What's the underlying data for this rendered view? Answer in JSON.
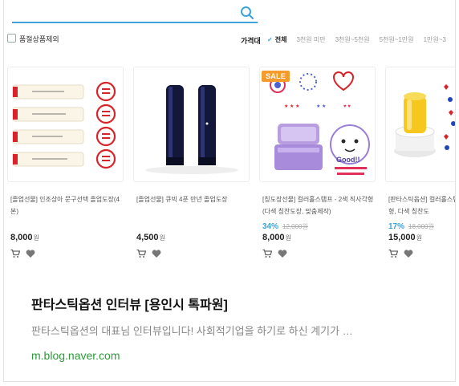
{
  "exclude_label": "품절상품제외",
  "price_filter": {
    "label": "가격대",
    "options": [
      "전체",
      "3천원 미만",
      "3천원~5천원",
      "5천원~1만원",
      "1만원~3"
    ]
  },
  "products": [
    {
      "name": "[졸업선물] 인조상아 문구선택 졸업도장(4본)",
      "discount": "",
      "original_price": "",
      "price": "8,000",
      "currency": "원",
      "sale": ""
    },
    {
      "name": "[졸업선물] 큐빅 4푼 만년 졸업도장",
      "discount": "",
      "original_price": "",
      "price": "4,500",
      "currency": "원",
      "sale": ""
    },
    {
      "name": "[칭도장선물] 컬러홀스탬프 - 2색 직사각형 (다색 칭찬도장, 맞춤제작)",
      "discount": "34%",
      "original_price": "12,000원",
      "price": "8,000",
      "currency": "원",
      "sale": "SALE"
    },
    {
      "name": "[판타스틱옵션] 컬러홀스탬프 지칙★ ( 원형, 다색 칭찬도",
      "discount": "17%",
      "original_price": "18,000원",
      "price": "15,000",
      "currency": "원",
      "sale": ""
    }
  ],
  "thumb_text": {
    "good": "Good!!"
  },
  "post": {
    "title": "판타스틱옵션 인터뷰 [용인시 톡파원]",
    "description": "판타스틱옵션의 대표님 인터뷰입니다! 사회적기업을 하기로 하신 계기가 …",
    "source": "m.blog.naver.com"
  },
  "colors": {
    "accent": "#3ea3d9",
    "sale": "#f59b2b",
    "link": "#2e9a3c",
    "stamp_red": "#d8232a"
  },
  "icons": [
    "search-icon",
    "checkbox-icon",
    "check-icon",
    "cart-icon",
    "heart-icon"
  ]
}
